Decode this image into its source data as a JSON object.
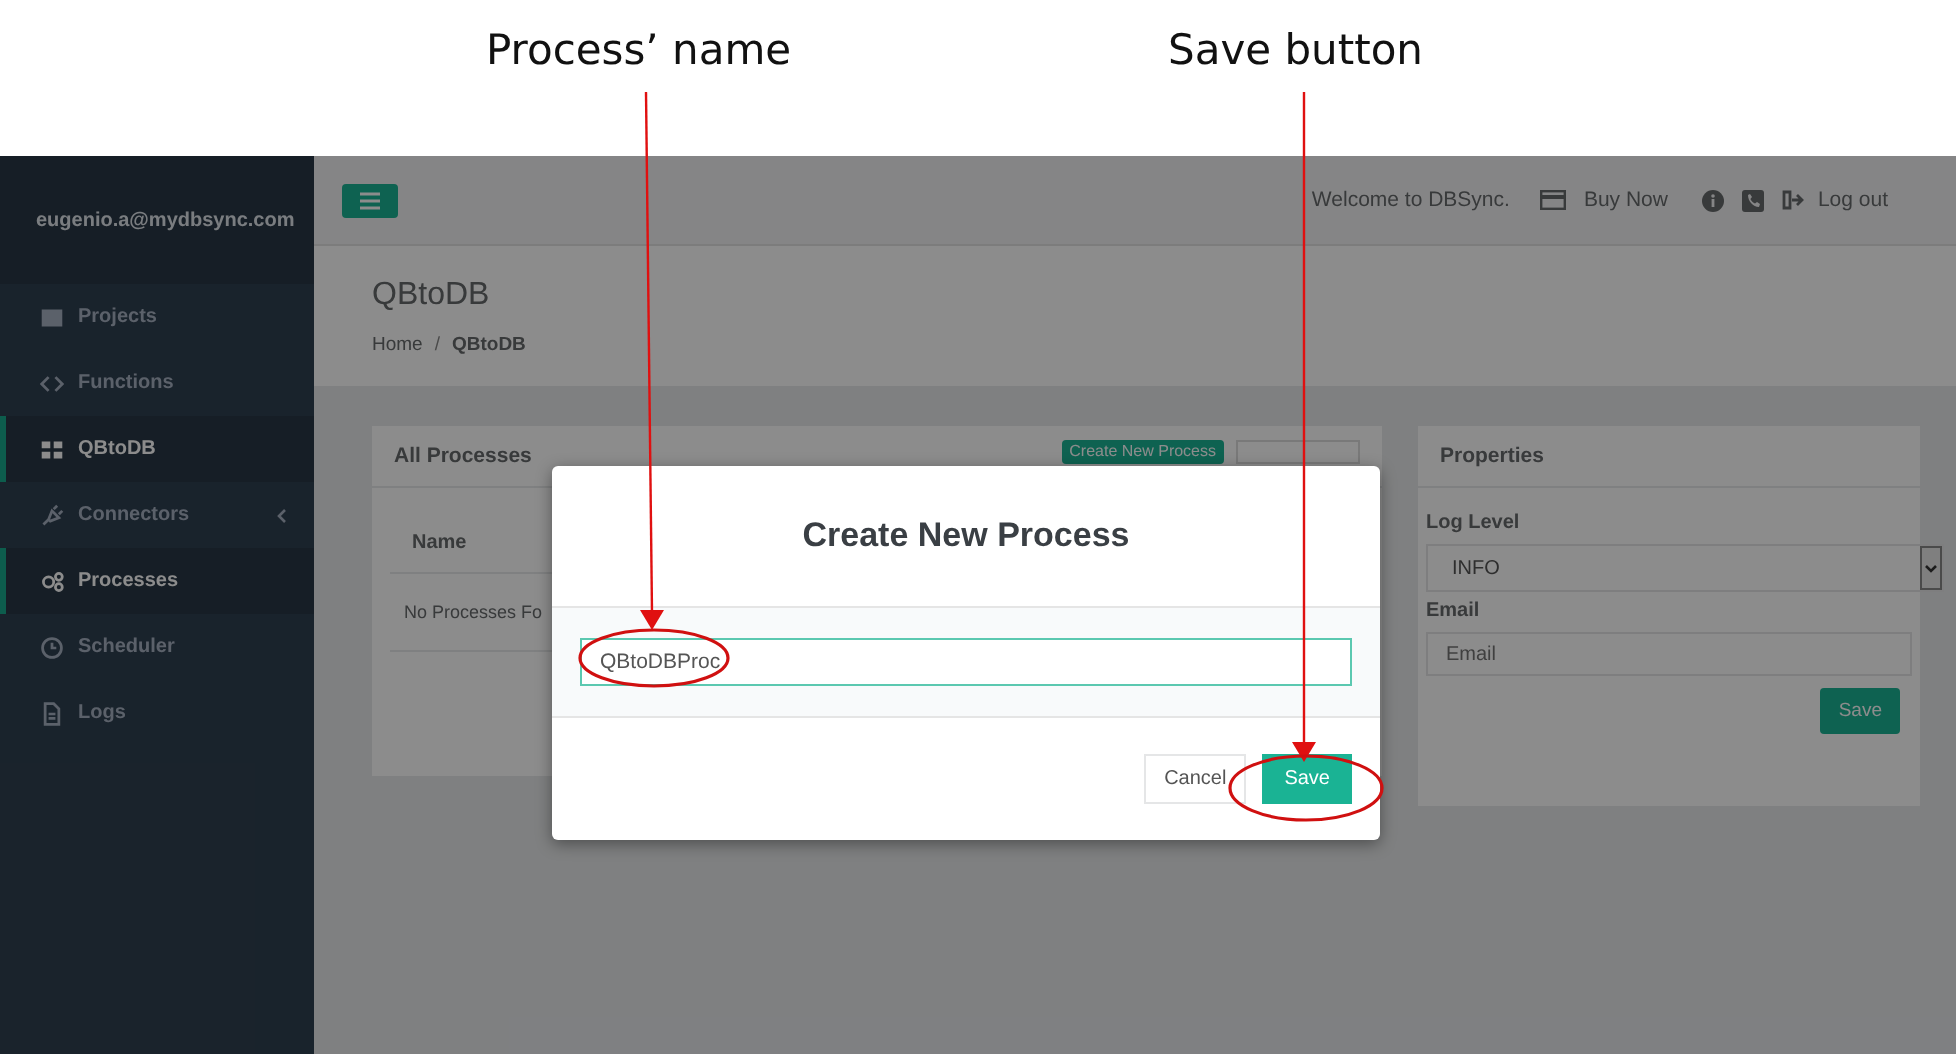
{
  "annotations": [
    {
      "label": "Process’ name"
    },
    {
      "label": "Save button"
    }
  ],
  "sidebar": {
    "user": "eugenio.a@mydbsync.com",
    "items": [
      {
        "label": "Projects",
        "selected": false
      },
      {
        "label": "Functions",
        "selected": false
      },
      {
        "label": "QBtoDB",
        "selected": true
      },
      {
        "label": "Connectors",
        "selected": false,
        "expanded": false
      },
      {
        "label": "Processes",
        "selected": true
      },
      {
        "label": "Scheduler",
        "selected": false
      },
      {
        "label": "Logs",
        "selected": false
      }
    ]
  },
  "top_bar": {
    "welcome": "Welcome to DBSync.",
    "buy": "Buy Now",
    "logout": "Log out"
  },
  "page_header": {
    "title": "QBtoDB",
    "breadcrumb": [
      "Home",
      "QBtoDB"
    ],
    "separator": "/"
  },
  "processes_panel": {
    "title": "All Processes",
    "create_button": "Create New Process",
    "columns": [
      "Name"
    ],
    "empty_text": "No Processes Fo"
  },
  "properties": {
    "title": "Properties",
    "log_level_label": "Log Level",
    "log_level": "INFO",
    "email_label": "Email",
    "email_placeholder": "Email",
    "save": "Save"
  },
  "dialog": {
    "title": "Create New Process",
    "name_value": "QBtoDBProc",
    "cancel": "Cancel",
    "save": "Save"
  }
}
